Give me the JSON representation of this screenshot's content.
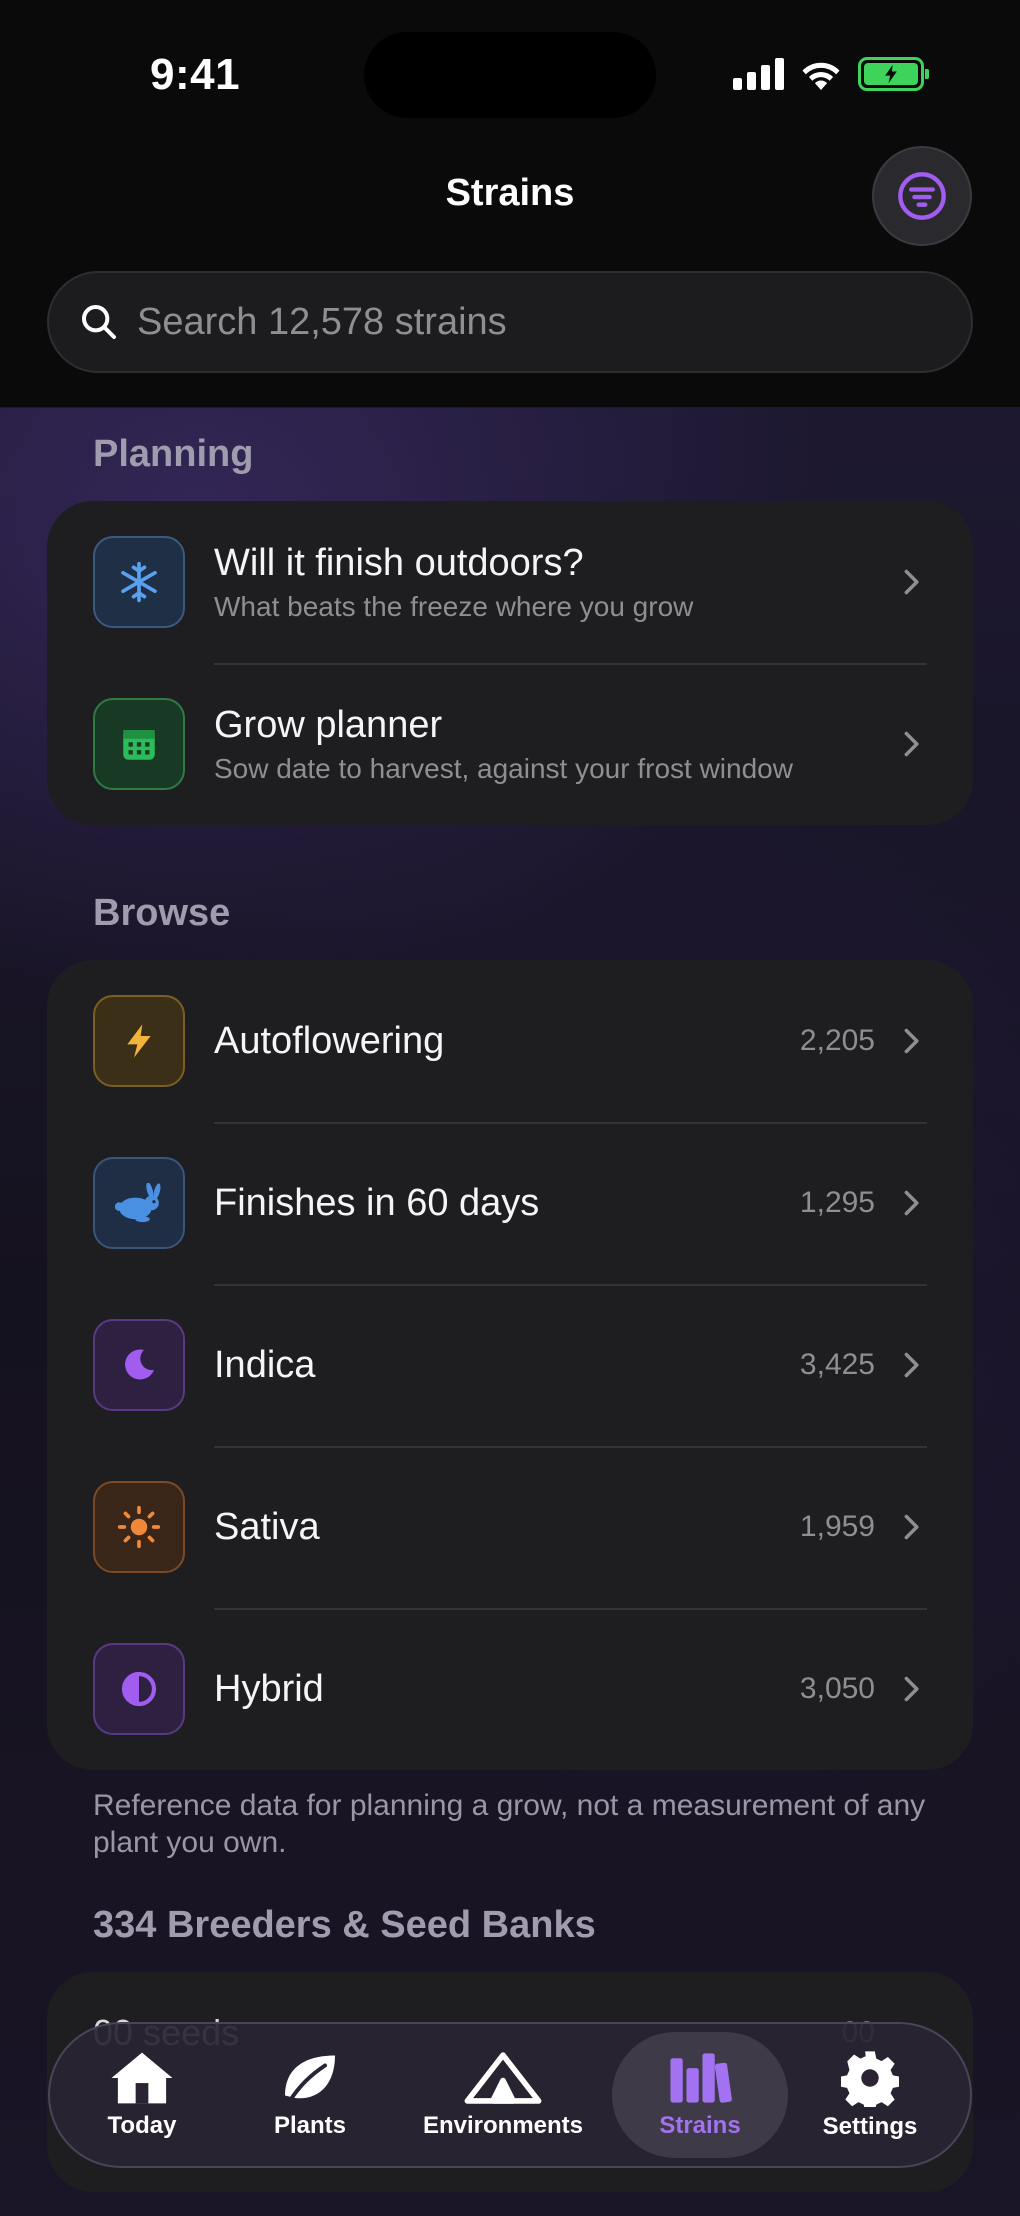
{
  "status_bar": {
    "time": "9:41"
  },
  "header": {
    "title": "Strains"
  },
  "search": {
    "placeholder": "Search 12,578 strains"
  },
  "planning": {
    "title": "Planning",
    "items": [
      {
        "title": "Will it finish outdoors?",
        "subtitle": "What beats the freeze where you grow",
        "icon": "snowflake-icon"
      },
      {
        "title": "Grow planner",
        "subtitle": "Sow date to harvest, against your frost window",
        "icon": "calendar-icon"
      }
    ]
  },
  "browse": {
    "title": "Browse",
    "items": [
      {
        "label": "Autoflowering",
        "count": "2,205",
        "icon": "lightning-icon",
        "color": "#f2b33d"
      },
      {
        "label": "Finishes in 60 days",
        "count": "1,295",
        "icon": "rabbit-icon",
        "color": "#4a90e2"
      },
      {
        "label": "Indica",
        "count": "3,425",
        "icon": "moon-icon",
        "color": "#a15cf0"
      },
      {
        "label": "Sativa",
        "count": "1,959",
        "icon": "sun-icon",
        "color": "#f0883a"
      },
      {
        "label": "Hybrid",
        "count": "3,050",
        "icon": "half-circle-icon",
        "color": "#a15cf0"
      }
    ]
  },
  "footnote": "Reference data for planning a grow, not a measurement of any plant you own.",
  "breeders": {
    "title": "334 Breeders & Seed Banks",
    "partial_label": "00 seeds",
    "partial_count": "00"
  },
  "tabbar": {
    "tabs": [
      {
        "label": "Today",
        "icon": "house-icon",
        "active": false
      },
      {
        "label": "Plants",
        "icon": "leaf-icon",
        "active": false
      },
      {
        "label": "Environments",
        "icon": "tent-icon",
        "active": false
      },
      {
        "label": "Strains",
        "icon": "books-icon",
        "active": true
      },
      {
        "label": "Settings",
        "icon": "gear-icon",
        "active": false
      }
    ]
  },
  "colors": {
    "accent": "#a15cf0",
    "battery": "#3ed35a",
    "card": "#1e1e21"
  }
}
